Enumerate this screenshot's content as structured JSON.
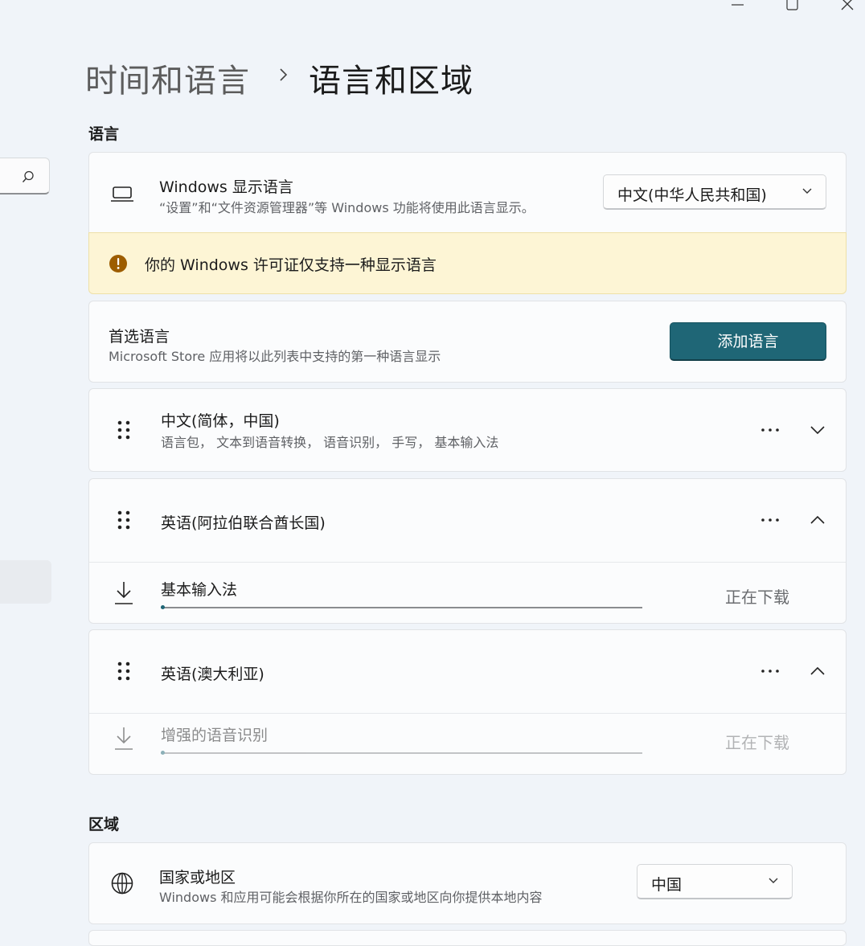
{
  "window": {
    "minimize_icon": "minimize-icon",
    "maximize_icon": "maximize-icon",
    "close_icon": "close-icon"
  },
  "sidebar": {
    "search_icon": "search-icon"
  },
  "breadcrumb": {
    "parent": "时间和语言",
    "separator_icon": "chevron-right-icon",
    "current": "语言和区域"
  },
  "language_section": {
    "title": "语言",
    "display_language": {
      "icon": "laptop-icon",
      "title": "Windows 显示语言",
      "subtitle": "“设置”和“文件资源管理器”等 Windows 功能将使用此语言显示。",
      "selected": "中文(中华人民共和国)"
    },
    "license_warning": {
      "icon": "warning-icon",
      "text": "你的 Windows 许可证仅支持一种显示语言"
    },
    "preferred": {
      "title": "首选语言",
      "subtitle": "Microsoft Store 应用将以此列表中支持的第一种语言显示",
      "add_button": "添加语言"
    },
    "languages": [
      {
        "name": "中文(简体，中国)",
        "features": "语言包， 文本到语音转换， 语音识别， 手写， 基本输入法",
        "expanded": false
      },
      {
        "name": "英语(阿拉伯联合酋长国)",
        "expanded": true,
        "download": {
          "name": "基本输入法",
          "status": "正在下载",
          "progress_percent": 0
        }
      },
      {
        "name": "英语(澳大利亚)",
        "expanded": true,
        "download": {
          "name": "增强的语音识别",
          "status": "正在下载",
          "progress_percent": 0
        }
      }
    ]
  },
  "region_section": {
    "title": "区域",
    "country": {
      "icon": "globe-icon",
      "title": "国家或地区",
      "subtitle": "Windows 和应用可能会根据你所在的国家或地区向你提供本地内容",
      "selected": "中国"
    }
  },
  "colors": {
    "accent": "#1f6676",
    "warning_bg": "#fdf5d5",
    "warning_icon": "#9d5d00"
  }
}
